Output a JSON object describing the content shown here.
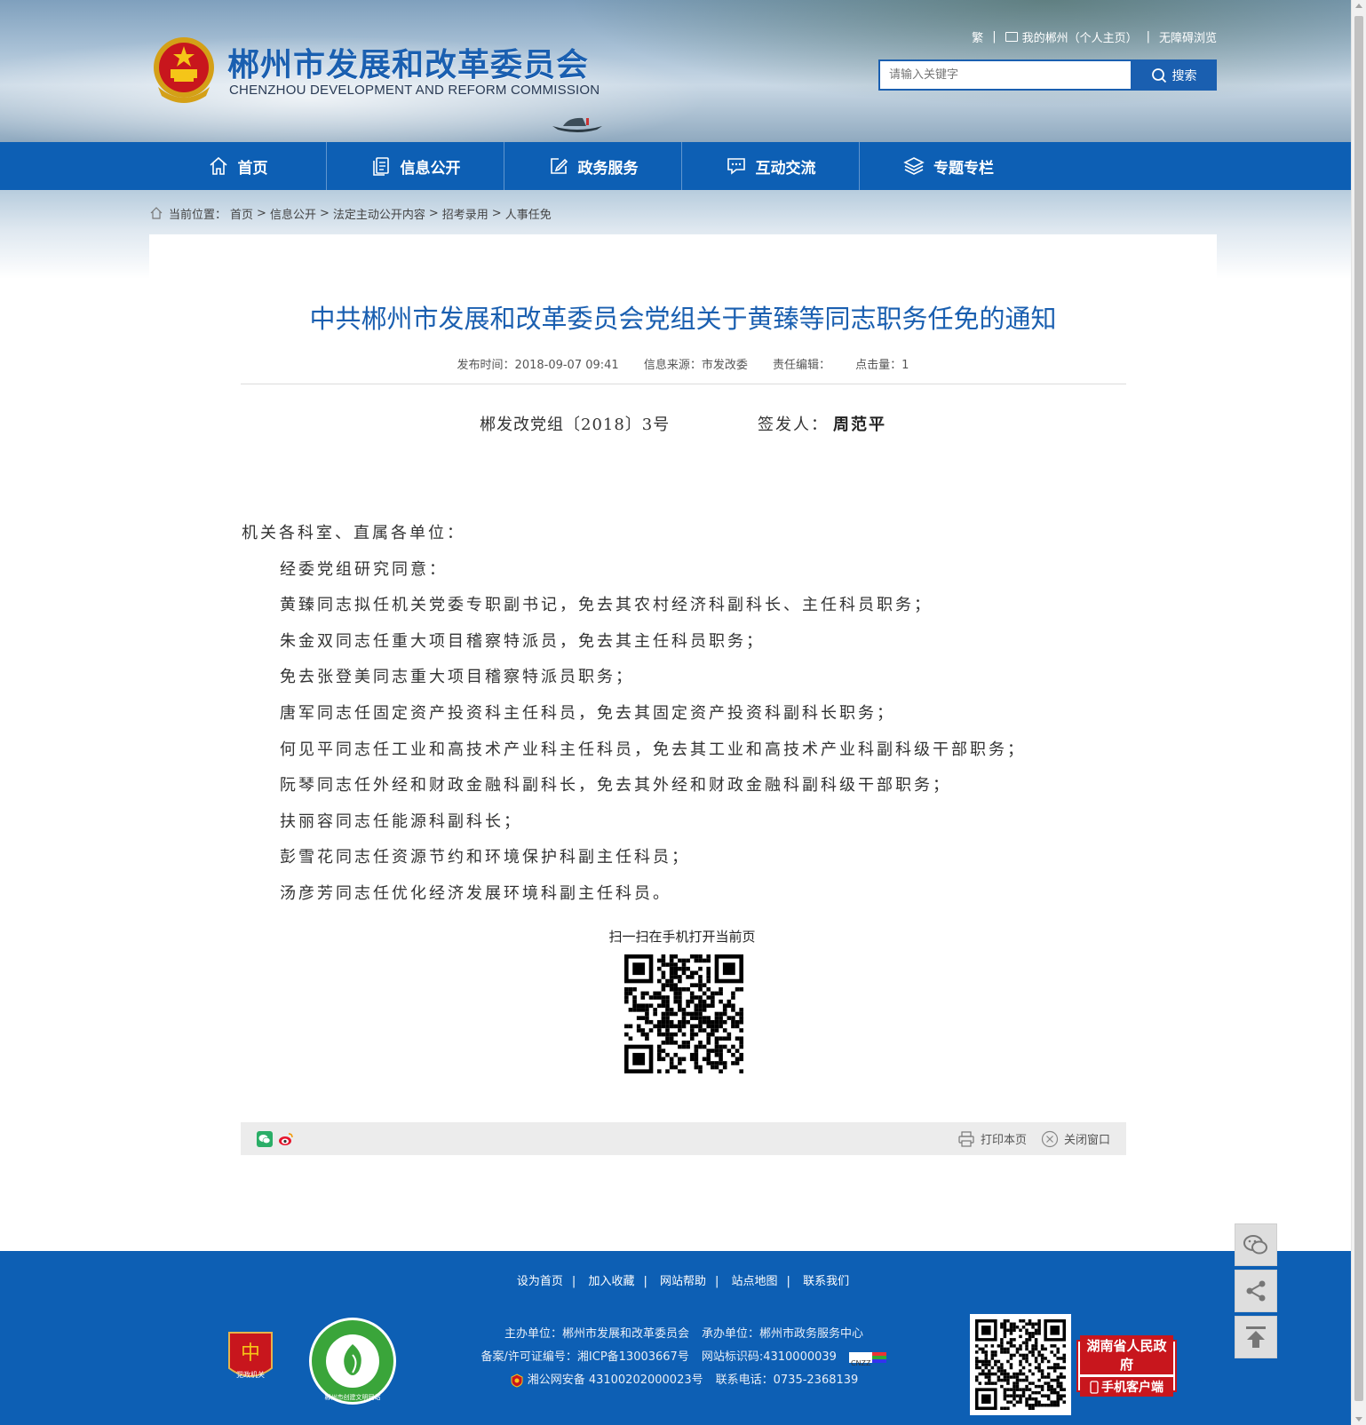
{
  "header": {
    "site_title": "郴州市发展和改革委员会",
    "site_subtitle": "CHENZHOU DEVELOPMENT AND REFORM COMMISSION",
    "top_links": {
      "traditional": "繁",
      "my_chenzhou": "我的郴州（个人主页）",
      "accessibility": "无障碍浏览"
    },
    "search": {
      "placeholder": "请输入关键字",
      "button_label": "搜索"
    }
  },
  "nav": {
    "items": [
      {
        "label": "首页",
        "icon": "home-icon"
      },
      {
        "label": "信息公开",
        "icon": "document-icon"
      },
      {
        "label": "政务服务",
        "icon": "edit-icon"
      },
      {
        "label": "互动交流",
        "icon": "chat-icon"
      },
      {
        "label": "专题专栏",
        "icon": "layers-icon"
      }
    ]
  },
  "breadcrumb": {
    "label": "当前位置：",
    "items": [
      "首页",
      "信息公开",
      "法定主动公开内容",
      "招考录用",
      "人事任免"
    ],
    "separator": ">"
  },
  "article": {
    "title": "中共郴州市发展和改革委员会党组关于黄臻等同志职务任免的通知",
    "meta": {
      "publish_time": "发布时间：2018-09-07 09:41",
      "source": "信息来源：市发改委",
      "editor": "责任编辑：",
      "hits": "点击量：1"
    },
    "doc_number": "郴发改党组〔2018〕3号",
    "signer_label": "签发人：",
    "signer_name": "周范平",
    "paragraphs": [
      {
        "text": "机关各科室、直属各单位：",
        "indent": false
      },
      {
        "text": "经委党组研究同意：",
        "indent": true
      },
      {
        "text": "黄臻同志拟任机关党委专职副书记，免去其农村经济科副科长、主任科员职务；",
        "indent": true
      },
      {
        "text": "朱金双同志任重大项目稽察特派员，免去其主任科员职务；",
        "indent": true
      },
      {
        "text": "免去张登美同志重大项目稽察特派员职务；",
        "indent": true
      },
      {
        "text": "唐军同志任固定资产投资科主任科员，免去其固定资产投资科副科长职务；",
        "indent": true
      },
      {
        "text": "何见平同志任工业和高技术产业科主任科员，免去其工业和高技术产业科副科级干部职务；",
        "indent": true
      },
      {
        "text": "阮琴同志任外经和财政金融科副科长，免去其外经和财政金融科副科级干部职务；",
        "indent": true
      },
      {
        "text": "扶丽容同志任能源科副科长；",
        "indent": true
      },
      {
        "text": "彭雪花同志任资源节约和环境保护科副主任科员；",
        "indent": true
      },
      {
        "text": "汤彦芳同志任优化经济发展环境科副主任科员。",
        "indent": true
      }
    ],
    "qr_caption": "扫一扫在手机打开当前页"
  },
  "toolbar": {
    "print_label": "打印本页",
    "close_label": "关闭窗口"
  },
  "footer": {
    "links": [
      "设为首页",
      "加入收藏",
      "网站帮助",
      "站点地图",
      "联系我们"
    ],
    "sponsor": "主办单位：郴州市发展和改革委员会",
    "organizer": "承办单位：郴州市政务服务中心",
    "icp": "备案/许可证编号：湘ICP备13003667号",
    "site_id": "网站标识码:4310000039",
    "police": "湘公网安备 43100202000023号",
    "phone": "联系电话：0735-2368139",
    "badge1_text": "党政机关",
    "badge2_text": "郴州市创建文明网站",
    "gov_app_line1": "湖南省人民政府",
    "gov_app_line2": "手机客户端",
    "cnzz": "CNZZ"
  },
  "colors": {
    "brand_blue": "#0d5fb4",
    "title_blue": "#1a5fb0",
    "gov_red": "#c8161d"
  }
}
